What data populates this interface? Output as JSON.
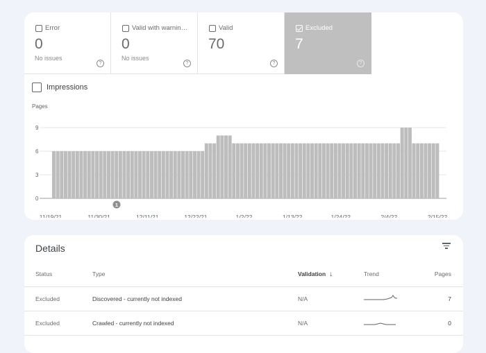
{
  "tiles": [
    {
      "label": "Error",
      "value": "0",
      "sub": "No issues",
      "selected": false
    },
    {
      "label": "Valid with warnin…",
      "value": "0",
      "sub": "No issues",
      "selected": false
    },
    {
      "label": "Valid",
      "value": "70",
      "sub": "",
      "selected": false
    },
    {
      "label": "Excluded",
      "value": "7",
      "sub": "",
      "selected": true
    }
  ],
  "help_glyph": "?",
  "impressions_label": "Impressions",
  "chart_data": {
    "type": "bar",
    "ylabel": "Pages",
    "ylim": [
      0,
      9
    ],
    "yticks": [
      0,
      3,
      6,
      9
    ],
    "xtick_labels": [
      "11/19/21",
      "11/30/21",
      "12/11/21",
      "12/22/21",
      "1/2/22",
      "1/13/22",
      "1/24/22",
      "2/4/22",
      "2/15/22"
    ],
    "values": [
      6,
      6,
      6,
      6,
      6,
      6,
      6,
      6,
      6,
      6,
      6,
      6,
      6,
      6,
      6,
      6,
      6,
      6,
      6,
      6,
      6,
      6,
      6,
      6,
      6,
      6,
      6,
      6,
      6,
      6,
      6,
      6,
      6,
      6,
      6,
      6,
      6,
      6,
      6,
      7,
      7,
      7,
      8,
      8,
      8,
      8,
      7,
      7,
      7,
      7,
      7,
      7,
      7,
      7,
      7,
      7,
      7,
      7,
      7,
      7,
      7,
      7,
      7,
      7,
      7,
      7,
      7,
      7,
      7,
      7,
      7,
      7,
      7,
      7,
      7,
      7,
      7,
      7,
      7,
      7,
      7,
      7,
      7,
      7,
      7,
      7,
      7,
      7,
      7,
      9,
      9,
      9,
      7,
      7,
      7,
      7,
      7,
      7,
      7
    ],
    "annotation": {
      "label": "1",
      "index": 16
    },
    "bar_color": "#bdbdbd"
  },
  "details": {
    "title": "Details",
    "columns": {
      "status": "Status",
      "type": "Type",
      "validation": "Validation",
      "trend": "Trend",
      "pages": "Pages"
    },
    "sort_glyph": "↓",
    "rows": [
      {
        "status": "Excluded",
        "type": "Discovered - currently not indexed",
        "validation": "N/A",
        "pages": "7"
      },
      {
        "status": "Excluded",
        "type": "Crawled - currently not indexed",
        "validation": "N/A",
        "pages": "0"
      }
    ]
  }
}
